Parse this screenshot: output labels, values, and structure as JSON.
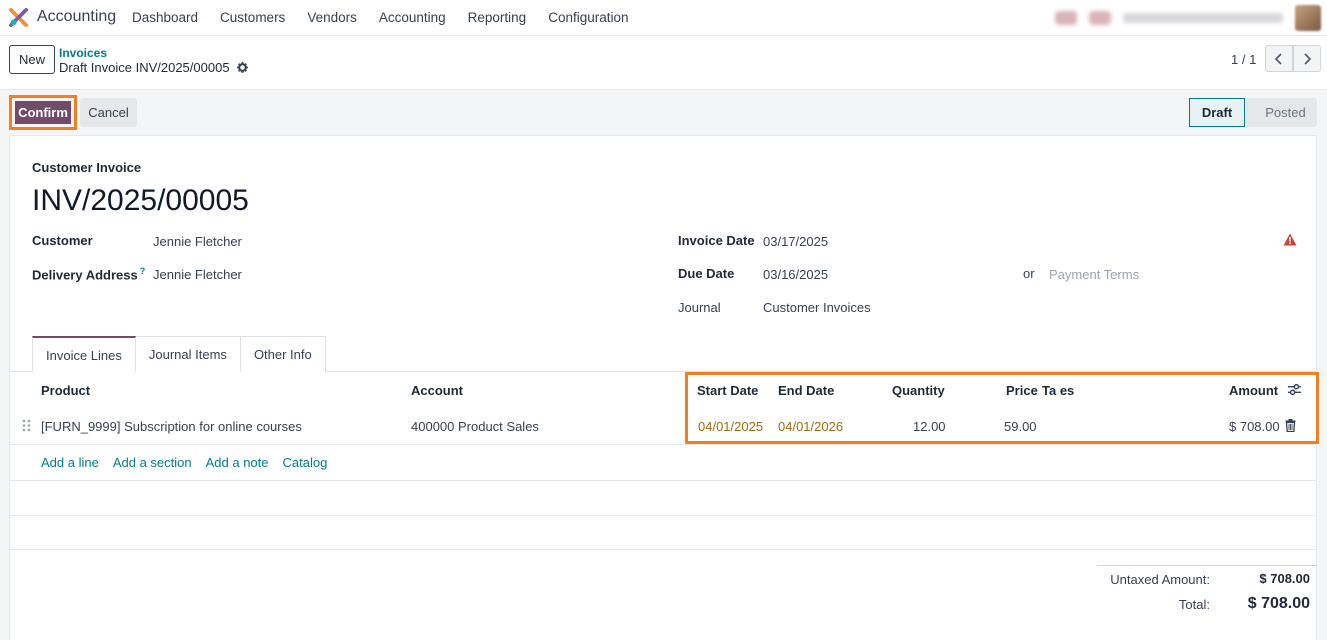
{
  "navbar": {
    "app_name": "Accounting",
    "menu": [
      "Dashboard",
      "Customers",
      "Vendors",
      "Accounting",
      "Reporting",
      "Configuration"
    ]
  },
  "control_panel": {
    "new_label": "New",
    "breadcrumb_parent": "Invoices",
    "breadcrumb_current": "Draft Invoice INV/2025/00005",
    "pager": "1 / 1"
  },
  "actions": {
    "confirm_label": "Confirm",
    "cancel_label": "Cancel"
  },
  "status": {
    "stages": [
      "Draft",
      "Posted"
    ],
    "active": "Draft"
  },
  "invoice": {
    "type_label": "Customer Invoice",
    "number": "INV/2025/00005",
    "customer_label": "Customer",
    "customer": "Jennie Fletcher",
    "delivery_label": "Delivery Address",
    "delivery_help": "?",
    "delivery_address": "Jennie Fletcher",
    "invoice_date_label": "Invoice Date",
    "invoice_date": "03/17/2025",
    "due_date_label": "Due Date",
    "due_date": "03/16/2025",
    "or_label": "or",
    "payment_terms_placeholder": "Payment Terms",
    "journal_label": "Journal",
    "journal": "Customer Invoices"
  },
  "tabs": [
    "Invoice Lines",
    "Journal Items",
    "Other Info"
  ],
  "lines": {
    "headers": {
      "product": "Product",
      "account": "Account",
      "start_date": "Start Date",
      "end_date": "End Date",
      "quantity": "Quantity",
      "price": "Price",
      "taxes": "Ta es",
      "amount": "Amount"
    },
    "rows": [
      {
        "product": "[FURN_9999] Subscription for online courses",
        "account": "400000 Product Sales",
        "start_date": "04/01/2025",
        "end_date": "04/01/2026",
        "quantity": "12.00",
        "price": "59.00",
        "amount": "$ 708.00"
      }
    ],
    "add_actions": [
      "Add a line",
      "Add a section",
      "Add a note",
      "Catalog"
    ]
  },
  "totals": {
    "untaxed_label": "Untaxed Amount:",
    "untaxed": "$ 708.00",
    "total_label": "Total:",
    "total": "$ 708.00"
  },
  "colors": {
    "brand": "#714b67",
    "link": "#017e84",
    "highlight": "#f47e20",
    "date_text": "#a16a0a"
  }
}
